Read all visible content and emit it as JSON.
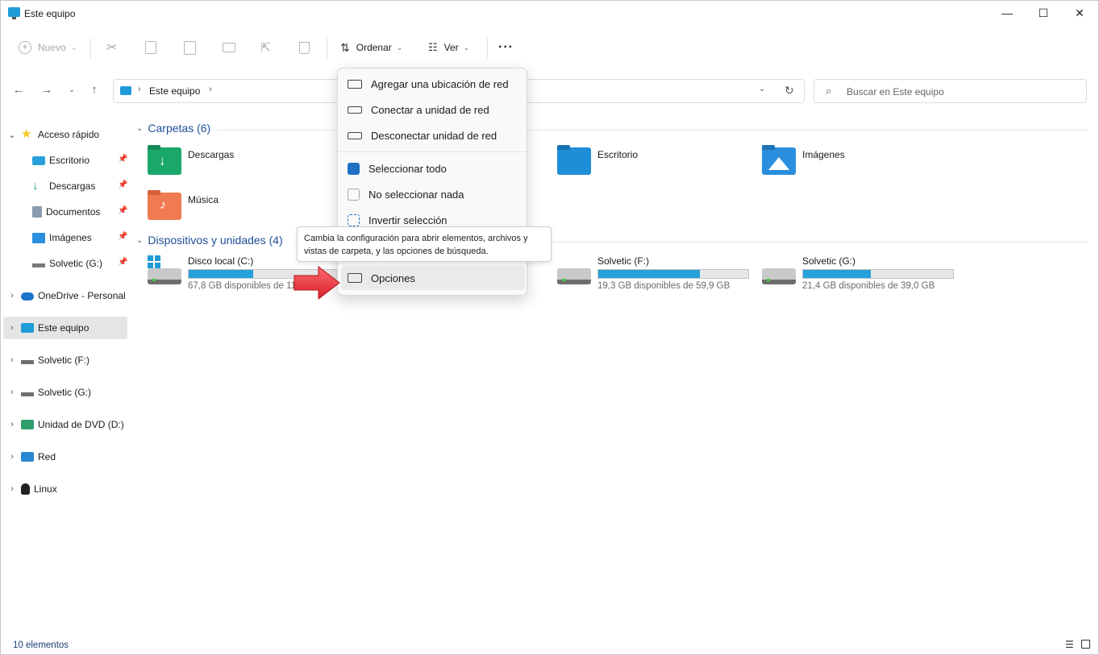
{
  "window": {
    "title": "Este equipo",
    "minimize": "—",
    "maximize": "☐",
    "close": "✕"
  },
  "toolbar": {
    "nuevo": "Nuevo",
    "ordenar": "Ordenar",
    "ver": "Ver",
    "more": "···"
  },
  "address": {
    "crumb": "Este equipo"
  },
  "search": {
    "placeholder": "Buscar en Este equipo"
  },
  "sidebar": {
    "quick_access": "Acceso rápido",
    "quick_items": [
      "Escritorio",
      "Descargas",
      "Documentos",
      "Imágenes",
      "Solvetic (G:)"
    ],
    "onedrive": "OneDrive - Personal",
    "this_pc": "Este equipo",
    "f_drive": "Solvetic (F:)",
    "g_drive": "Solvetic (G:)",
    "dvd": "Unidad de DVD (D:)",
    "red": "Red",
    "linux": "Linux"
  },
  "sections": {
    "folders": "Carpetas (6)",
    "devices": "Dispositivos y unidades (4)"
  },
  "folders": [
    {
      "name": "Descargas",
      "color": "#1aa86a"
    },
    {
      "name": "Escritorio",
      "color": "#1f8ed8"
    },
    {
      "name": "Imágenes",
      "color": "#2b8fe0"
    },
    {
      "name": "Música",
      "color": "#f07a52"
    }
  ],
  "drives": [
    {
      "name": "Disco local (C:)",
      "free": "67,8 GB disponibles de 118 GB",
      "used_fraction": 0.43
    },
    {
      "name": "Solvetic (F:)",
      "free": "19,3 GB disponibles de 59,9 GB",
      "used_fraction": 0.68
    },
    {
      "name": "Solvetic (G:)",
      "free": "21,4 GB disponibles de 39,0 GB",
      "used_fraction": 0.45
    }
  ],
  "menu": {
    "items": [
      "Agregar una ubicación de red",
      "Conectar a unidad de red",
      "Desconectar unidad de red",
      "Seleccionar todo",
      "No seleccionar nada",
      "Invertir selección",
      "Opciones"
    ],
    "tooltip": "Cambia la configuración para abrir elementos, archivos y vistas de carpeta, y las opciones de búsqueda."
  },
  "status": {
    "count": "10 elementos"
  },
  "colors": {
    "accent": "#26a0da",
    "section_title": "#1f4e99",
    "arrow": "#e8393f"
  }
}
